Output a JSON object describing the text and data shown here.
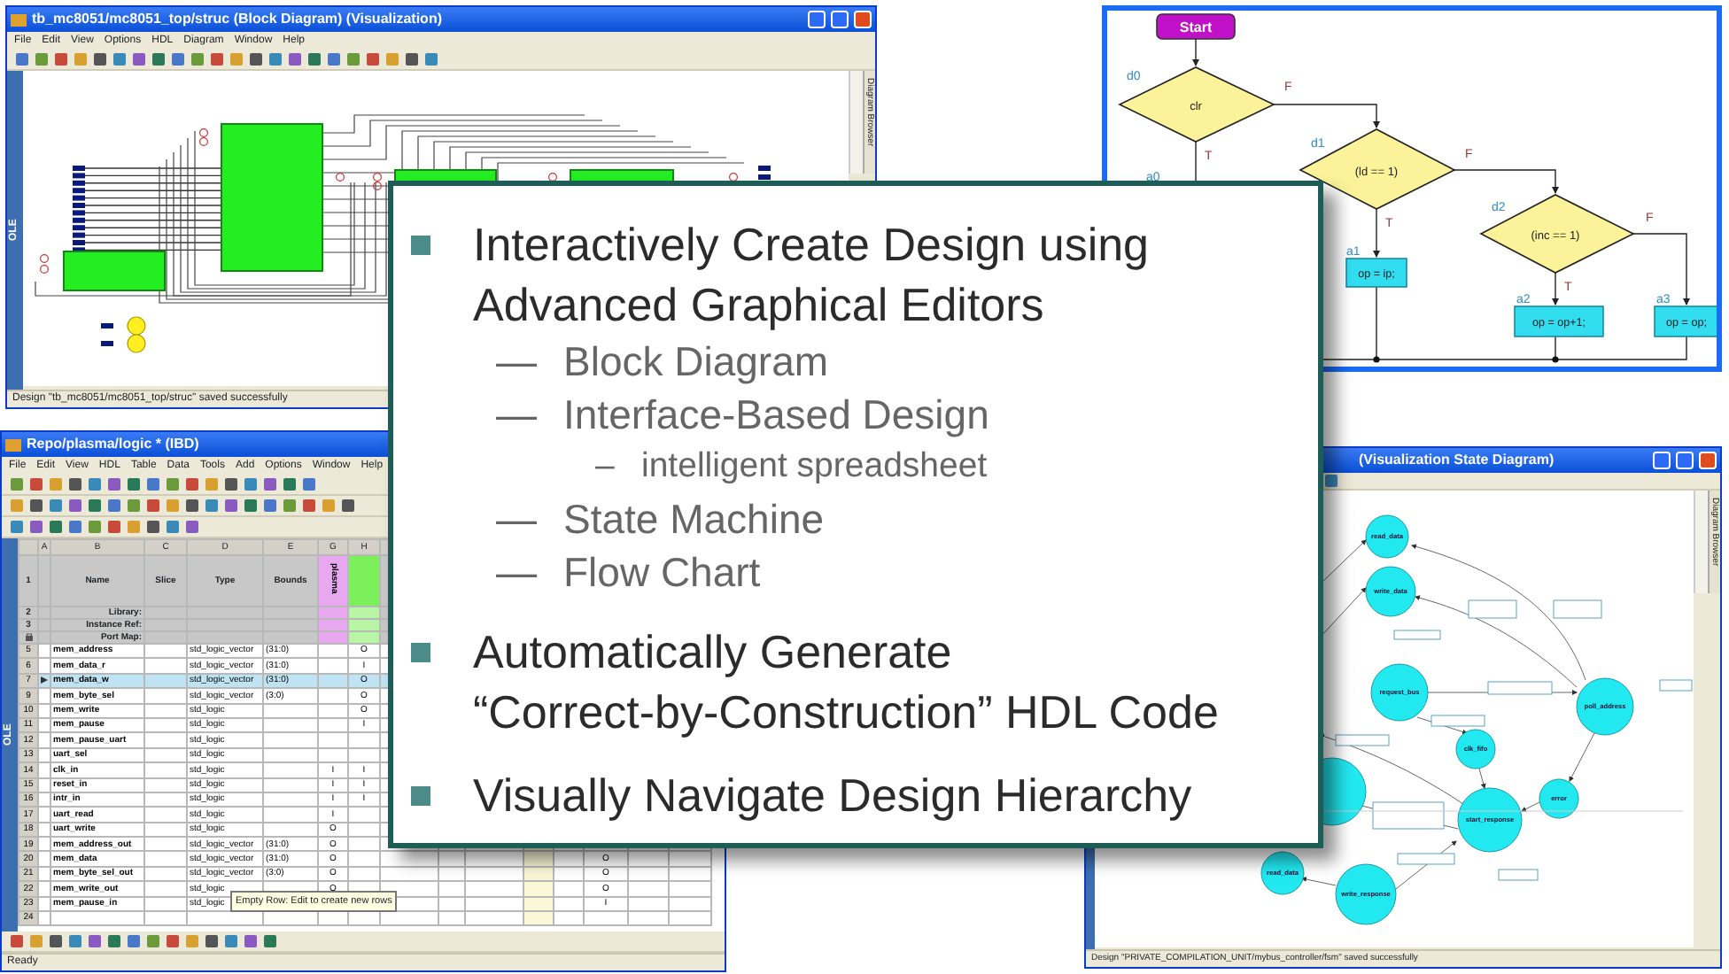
{
  "block_diagram_window": {
    "title": "tb_mc8051/mc8051_top/struc (Block Diagram) (Visualization)",
    "menu": [
      "File",
      "Edit",
      "View",
      "Options",
      "HDL",
      "Diagram",
      "Window",
      "Help"
    ],
    "side_tab": "OLE",
    "right_tab": "Diagram Browser",
    "status": "Design \"tb_mc8051/mc8051_top/struc\" saved successfully"
  },
  "flow_chart": {
    "start": "Start",
    "nodes": [
      {
        "kind": "decision",
        "id_label": "d0",
        "text": "clr",
        "false_label": "F",
        "true_label": "T"
      },
      {
        "kind": "action",
        "id_label": "a0"
      },
      {
        "kind": "decision",
        "id_label": "d1",
        "text": "(ld == 1)",
        "false_label": "F",
        "true_label": "T"
      },
      {
        "kind": "action",
        "id_label": "a1",
        "text": "op = ip;"
      },
      {
        "kind": "decision",
        "id_label": "d2",
        "text": "(inc == 1)",
        "false_label": "F",
        "true_label": "T"
      },
      {
        "kind": "action",
        "id_label": "a2",
        "text": "op = op+1;"
      },
      {
        "kind": "action",
        "id_label": "a3",
        "text": "op = op;"
      }
    ]
  },
  "spreadsheet_window": {
    "title": "Repo/plasma/logic * (IBD)",
    "menu": [
      "File",
      "Edit",
      "View",
      "HDL",
      "Table",
      "Data",
      "Tools",
      "Add",
      "Options",
      "Window",
      "Help"
    ],
    "side_tab": "OLE",
    "columns": [
      "A",
      "B",
      "C",
      "D",
      "E",
      "G",
      "H"
    ],
    "header": {
      "num": "1",
      "name": "Name",
      "slice": "Slice",
      "type": "Type",
      "bounds": "Bounds",
      "g": "plasma"
    },
    "meta_rows": [
      {
        "num": "2",
        "label": "Library:"
      },
      {
        "num": "3",
        "label": "Instance Ref:"
      },
      {
        "label": "Port Map:"
      }
    ],
    "rows": [
      {
        "num": "5",
        "name": "mem_address",
        "type": "std_logic_vector",
        "bounds": "(31:0)",
        "h": "O",
        "selected": false
      },
      {
        "num": "6",
        "name": "mem_data_r",
        "type": "std_logic_vector",
        "bounds": "(31:0)",
        "h": "I",
        "selected": false
      },
      {
        "num": "7",
        "name": "mem_data_w",
        "type": "std_logic_vector",
        "bounds": "(31:0)",
        "h": "O",
        "selected": true
      },
      {
        "num": "9",
        "name": "mem_byte_sel",
        "type": "std_logic_vector",
        "bounds": "(3:0)",
        "h": "O",
        "selected": false
      },
      {
        "num": "10",
        "name": "mem_write",
        "type": "std_logic",
        "h": "O",
        "selected": false
      },
      {
        "num": "11",
        "name": "mem_pause",
        "type": "std_logic",
        "h": "I",
        "selected": false
      },
      {
        "num": "12",
        "name": "mem_pause_uart",
        "type": "std_logic",
        "selected": false
      },
      {
        "num": "13",
        "name": "uart_sel",
        "type": "std_logic",
        "selected": false
      },
      {
        "num": "14",
        "name": "clk_in",
        "type": "std_logic",
        "g": "I",
        "h": "I",
        "selected": false
      },
      {
        "num": "15",
        "name": "reset_in",
        "type": "std_logic",
        "g": "I",
        "h": "I",
        "selected": false
      },
      {
        "num": "16",
        "name": "intr_in",
        "type": "std_logic",
        "g": "I",
        "h": "I",
        "selected": false
      },
      {
        "num": "17",
        "name": "uart_read",
        "type": "std_logic",
        "g": "I",
        "selected": false
      },
      {
        "num": "18",
        "name": "uart_write",
        "type": "std_logic",
        "g": "O",
        "selected": false
      },
      {
        "num": "19",
        "name": "mem_address_out",
        "type": "std_logic_vector",
        "bounds": "(31:0)",
        "g": "O",
        "selected": false
      },
      {
        "num": "20",
        "name": "mem_data",
        "type": "std_logic_vector",
        "bounds": "(31:0)",
        "g": "O",
        "n": "O",
        "selected": false
      },
      {
        "num": "21",
        "name": "mem_byte_sel_out",
        "type": "std_logic_vector",
        "bounds": "(3:0)",
        "g": "O",
        "n": "O",
        "selected": false
      },
      {
        "num": "22",
        "name": "mem_write_out",
        "type": "std_logic",
        "g": "O",
        "n": "O",
        "selected": false
      },
      {
        "num": "23",
        "name": "mem_pause_in",
        "type": "std_logic",
        "n": "I",
        "selected": false
      },
      {
        "num": "24",
        "selected": false
      }
    ],
    "tooltip": "Empty Row: Edit to create new rows",
    "status": "Ready"
  },
  "state_diagram_window": {
    "title": "(Visualization State Diagram)",
    "right_tab": "Diagram Browser",
    "states": [
      {
        "name": "read_data"
      },
      {
        "name": "write_data"
      },
      {
        "name": "request_bus"
      },
      {
        "name": "poll_address"
      },
      {
        "name": "clk_fifo"
      },
      {
        "name": "error"
      },
      {
        "name": "start_response"
      },
      {
        "name": "write_response"
      },
      {
        "name": "read_data"
      }
    ],
    "status": "Design \"PRIVATE_COMPILATION_UNIT/mybus_controller/fsm\" saved successfully"
  },
  "slide": {
    "bullets": [
      {
        "lines": [
          "Interactively Create Design using",
          "Advanced Graphical Editors"
        ],
        "children": [
          {
            "marker": "—",
            "text": "Block Diagram"
          },
          {
            "marker": "—",
            "text": "Interface-Based Design",
            "children": [
              {
                "marker": "–",
                "text": "intelligent spreadsheet"
              }
            ]
          },
          {
            "marker": "—",
            "text": "State Machine"
          },
          {
            "marker": "—",
            "text": "Flow Chart"
          }
        ]
      },
      {
        "lines": [
          "Automatically Generate",
          "“Correct-by-Construction” HDL Code"
        ]
      },
      {
        "lines": [
          "Visually Navigate Design Hierarchy"
        ]
      }
    ]
  }
}
